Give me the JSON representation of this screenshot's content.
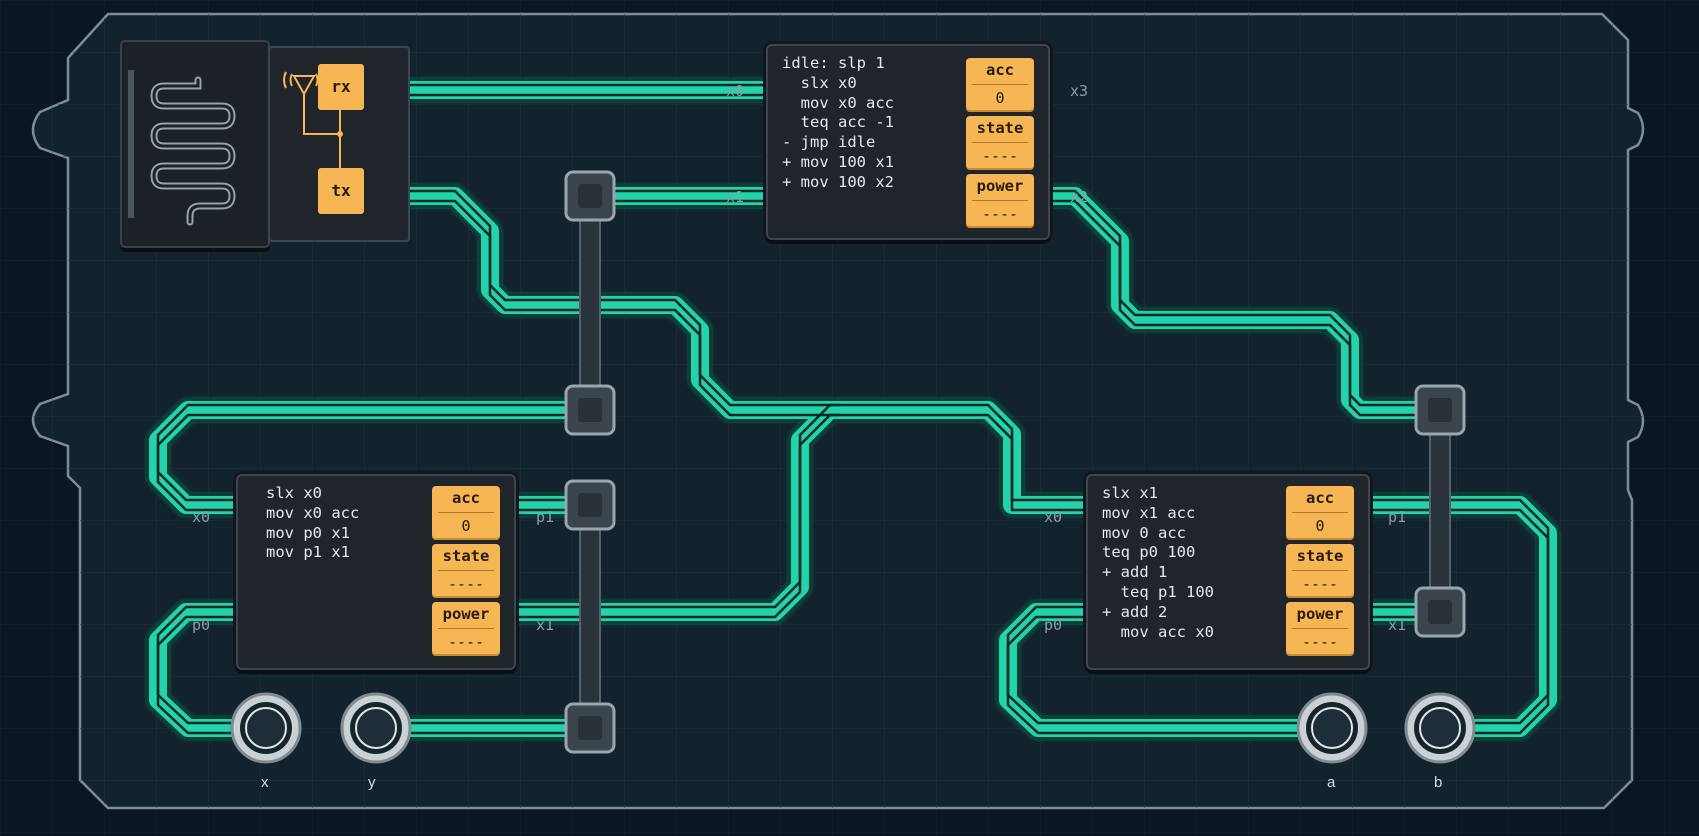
{
  "board": {
    "radio": {
      "rx_label": "rx",
      "tx_label": "tx",
      "icon": "antenna-icon",
      "sensor_icon": "serpentine-sensor-icon"
    },
    "controllers": [
      {
        "id": "top",
        "code": [
          "idle: slp 1",
          "  slx x0",
          "  mov x0 acc",
          "  teq acc -1",
          "- jmp idle",
          "+ mov 100 x1",
          "+ mov 100 x2"
        ],
        "registers": [
          {
            "label": "acc",
            "value": "0"
          },
          {
            "label": "state",
            "value": "----"
          },
          {
            "label": "power",
            "value": "----"
          }
        ],
        "pins_left": [
          "x0",
          "x1"
        ],
        "pins_right": [
          "x3",
          "x2"
        ]
      },
      {
        "id": "left",
        "code": [
          "slx x0",
          "mov x0 acc",
          "mov p0 x1",
          "mov p1 x1"
        ],
        "registers": [
          {
            "label": "acc",
            "value": "0"
          },
          {
            "label": "state",
            "value": "----"
          },
          {
            "label": "power",
            "value": "----"
          }
        ],
        "pins_left": [
          "x0",
          "p0"
        ],
        "pins_right": [
          "p1",
          "x1"
        ]
      },
      {
        "id": "right",
        "code": [
          "slx x1",
          "mov x1 acc",
          "mov 0 acc",
          "teq p0 100",
          "+ add 1",
          "  teq p1 100",
          "+ add 2",
          "  mov acc x0"
        ],
        "registers": [
          {
            "label": "acc",
            "value": "0"
          },
          {
            "label": "state",
            "value": "----"
          },
          {
            "label": "power",
            "value": "----"
          }
        ],
        "pins_left": [
          "x0",
          "p0"
        ],
        "pins_right": [
          "p1",
          "x1"
        ]
      }
    ],
    "buttons": [
      {
        "label": "x"
      },
      {
        "label": "y"
      },
      {
        "label": "a"
      },
      {
        "label": "b"
      }
    ],
    "colors": {
      "background": "#0b1821",
      "board": "#13242e",
      "grid": "#1f3440",
      "wire": "#1fc9a2",
      "register": "#f6b654",
      "controller": "#1f252b"
    }
  }
}
